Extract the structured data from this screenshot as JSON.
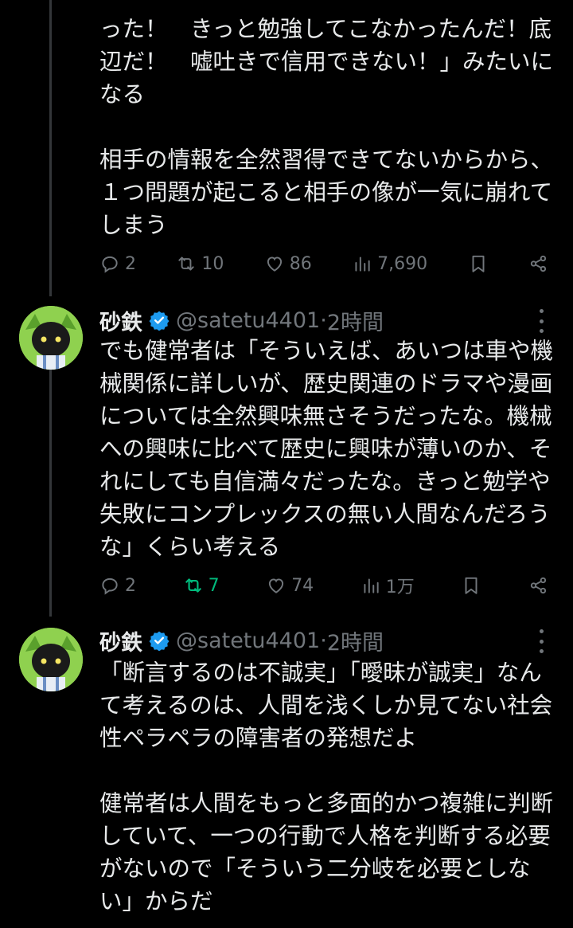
{
  "tweets": [
    {
      "body": "った！　きっと勉強してこなかったんだ！底辺だ！　嘘吐きで信用できない！」みたいになる\n\n相手の情報を全然習得できてないからから、１つ問題が起こると相手の像が一気に崩れてしまう",
      "replies": "2",
      "retweets": "10",
      "likes": "86",
      "views": "7,690"
    },
    {
      "name": "砂鉄",
      "handle": "@satetu4401",
      "time": "2時間",
      "body": "でも健常者は「そういえば、あいつは車や機械関係に詳しいが、歴史関連のドラマや漫画については全然興味無さそうだったな。機械への興味に比べて歴史に興味が薄いのか、それにしても自信満々だったな。きっと勉学や失敗にコンプレックスの無い人間なんだろうな」くらい考える",
      "replies": "2",
      "retweets": "7",
      "likes": "74",
      "views": "1万"
    },
    {
      "name": "砂鉄",
      "handle": "@satetu4401",
      "time": "2時間",
      "body": "「断言するのは不誠実」「曖昧が誠実」なんて考えるのは、人間を浅くしか見てない社会性ペラペラの障害者の発想だよ\n\n健常者は人間をもっと多面的かつ複雑に判断していて、一つの行動で人格を判断する必要がないので「そういう二分岐を必要としない」からだ"
    }
  ],
  "meta": {
    "separator": " · ",
    "retweet_active_color": "#00ba7c"
  },
  "icons": [
    "reply-icon",
    "retweet-icon",
    "like-icon",
    "views-icon",
    "bookmark-icon",
    "share-icon",
    "verified-icon",
    "more-icon"
  ]
}
